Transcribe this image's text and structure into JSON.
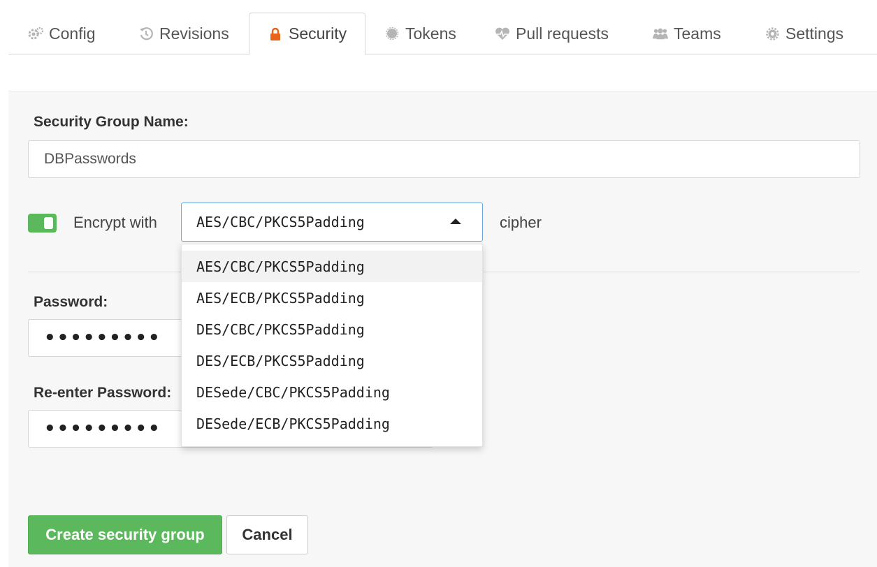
{
  "tabs": [
    {
      "label": "Config",
      "icon": "gears-icon",
      "active": false
    },
    {
      "label": "Revisions",
      "icon": "history-icon",
      "active": false
    },
    {
      "label": "Security",
      "icon": "lock-icon",
      "active": true
    },
    {
      "label": "Tokens",
      "icon": "token-icon",
      "active": false
    },
    {
      "label": "Pull requests",
      "icon": "heartbeat-icon",
      "active": false
    },
    {
      "label": "Teams",
      "icon": "users-icon",
      "active": false
    },
    {
      "label": "Settings",
      "icon": "gear-icon",
      "active": false
    }
  ],
  "form": {
    "group_name_label": "Security Group Name:",
    "group_name_value": "DBPasswords",
    "encrypt_toggle_on": true,
    "encrypt_with_label": "Encrypt with",
    "cipher_selected": "AES/CBC/PKCS5Padding",
    "cipher_suffix": "cipher",
    "cipher_options": [
      "AES/CBC/PKCS5Padding",
      "AES/ECB/PKCS5Padding",
      "DES/CBC/PKCS5Padding",
      "DES/ECB/PKCS5Padding",
      "DESede/CBC/PKCS5Padding",
      "DESede/ECB/PKCS5Padding"
    ],
    "password_label": "Password:",
    "password_mask": "•••••••••",
    "reenter_label": "Re-enter Password:",
    "reenter_mask": "•••••••••"
  },
  "buttons": {
    "create": "Create security group",
    "cancel": "Cancel"
  },
  "colors": {
    "accent_green": "#5cb85c",
    "lock_orange": "#e8641b",
    "focus_blue": "#6aa9e0",
    "icon_grey": "#b5b5b5"
  }
}
